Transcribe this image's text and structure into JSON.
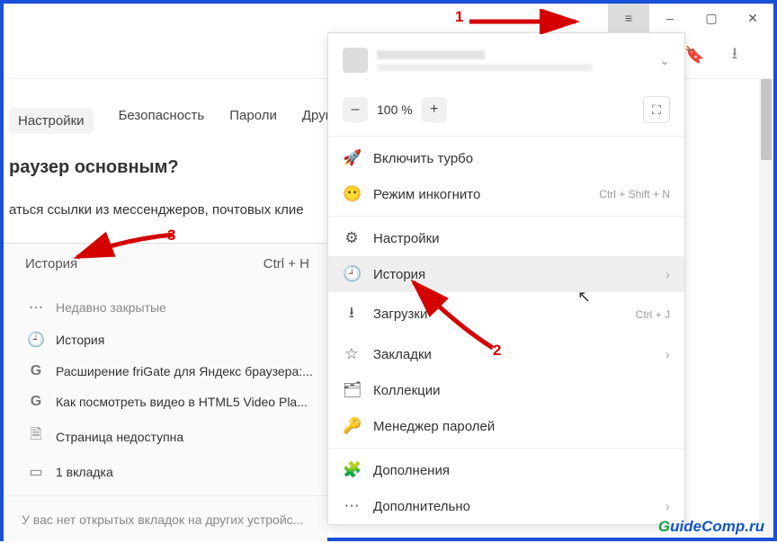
{
  "titlebar": {
    "minimize": "–",
    "maximize": "▢",
    "close": "✕",
    "menu_icon": "≡"
  },
  "toolbar": {
    "bookmark_icon": "🔖",
    "download_icon": "⭳"
  },
  "settings_tabs": [
    "Настройки",
    "Безопасность",
    "Пароли",
    "Другие у"
  ],
  "page": {
    "heading": "раузер основным?",
    "subtext": "аться ссылки из мессенджеров, почтовых клие"
  },
  "side_panel": {
    "title": "История",
    "shortcut": "Ctrl + H",
    "items": [
      {
        "icon": "recent",
        "label": "Недавно закрытые",
        "muted": true
      },
      {
        "icon": "clock",
        "label": "История"
      },
      {
        "icon": "G",
        "label": "Расширение friGate для Яндекс браузера:..."
      },
      {
        "icon": "G",
        "label": "Как посмотреть видео в HTML5 Video Pla..."
      },
      {
        "icon": "page",
        "label": "Страница недоступна"
      },
      {
        "icon": "tabs",
        "label": "1 вкладка"
      }
    ],
    "footer": "У вас нет открытых вкладок на других устройс..."
  },
  "menu": {
    "zoom": {
      "minus": "–",
      "value": "100 %",
      "plus": "+"
    },
    "items_a": [
      {
        "icon": "🚀",
        "label": "Включить турбо"
      },
      {
        "icon": "🥸",
        "label": "Режим инкогнито",
        "shortcut": "Ctrl + Shift + N"
      }
    ],
    "items_b": [
      {
        "icon": "⚙",
        "label": "Настройки"
      },
      {
        "icon": "🕘",
        "label": "История",
        "highlight": true,
        "chevron": true
      },
      {
        "icon": "⭳",
        "label": "Загрузки",
        "shortcut": "Ctrl + J"
      },
      {
        "icon": "☆",
        "label": "Закладки",
        "chevron": true
      },
      {
        "icon": "🗂",
        "label": "Коллекции"
      },
      {
        "icon": "🔑",
        "label": "Менеджер паролей"
      }
    ],
    "items_c": [
      {
        "icon": "🧩",
        "label": "Дополнения"
      },
      {
        "icon": "⋯",
        "label": "Дополнительно",
        "chevron": true
      }
    ]
  },
  "annotations": {
    "n1": "1",
    "n2": "2",
    "n3": "3"
  },
  "watermark": {
    "g": "G",
    "rest": "uideComp.ru"
  }
}
